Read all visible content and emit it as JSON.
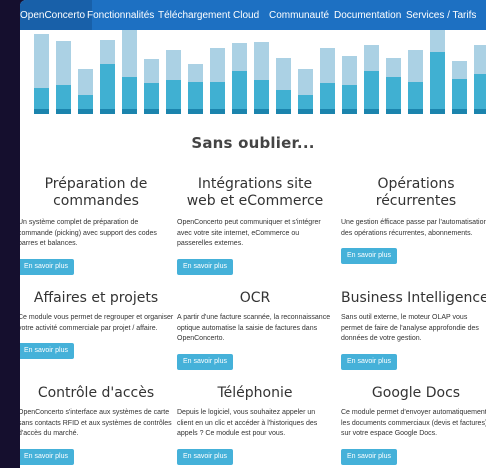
{
  "nav": {
    "items": [
      {
        "label": "OpenConcerto",
        "active": true
      },
      {
        "label": "Fonctionnalités",
        "active": false
      },
      {
        "label": "Téléchargement",
        "active": false
      },
      {
        "label": "Cloud",
        "active": false
      },
      {
        "label": "Communauté",
        "active": false
      },
      {
        "label": "Documentation",
        "active": false
      },
      {
        "label": "Services / Tarifs",
        "active": false
      }
    ]
  },
  "colors": {
    "nav_bg": "#1d70c2",
    "button_bg": "#45b1d9",
    "bar_light": "#abd1e4",
    "bar_mid": "#40b0d2",
    "bar_dark": "#1b84ad"
  },
  "hero": {
    "bars": [
      {
        "light": 0.68,
        "mid": 0.26,
        "dark": 0.06
      },
      {
        "light": 0.55,
        "mid": 0.3,
        "dark": 0.06
      },
      {
        "light": 0.32,
        "mid": 0.18,
        "dark": 0.06
      },
      {
        "light": 0.3,
        "mid": 0.56,
        "dark": 0.06
      },
      {
        "light": 0.8,
        "mid": 0.4,
        "dark": 0.06
      },
      {
        "light": 0.3,
        "mid": 0.32,
        "dark": 0.06
      },
      {
        "light": 0.38,
        "mid": 0.36,
        "dark": 0.06
      },
      {
        "light": 0.22,
        "mid": 0.34,
        "dark": 0.06
      },
      {
        "light": 0.42,
        "mid": 0.34,
        "dark": 0.06
      },
      {
        "light": 0.35,
        "mid": 0.48,
        "dark": 0.06
      },
      {
        "light": 0.48,
        "mid": 0.36,
        "dark": 0.06
      },
      {
        "light": 0.4,
        "mid": 0.24,
        "dark": 0.06
      },
      {
        "light": 0.32,
        "mid": 0.18,
        "dark": 0.06
      },
      {
        "light": 0.44,
        "mid": 0.32,
        "dark": 0.06
      },
      {
        "light": 0.36,
        "mid": 0.3,
        "dark": 0.06
      },
      {
        "light": 0.32,
        "mid": 0.48,
        "dark": 0.06
      },
      {
        "light": 0.24,
        "mid": 0.4,
        "dark": 0.06
      },
      {
        "light": 0.4,
        "mid": 0.34,
        "dark": 0.06
      },
      {
        "light": 0.3,
        "mid": 0.72,
        "dark": 0.06
      },
      {
        "light": 0.22,
        "mid": 0.38,
        "dark": 0.06
      },
      {
        "light": 0.36,
        "mid": 0.44,
        "dark": 0.06
      },
      {
        "light": 0.4,
        "mid": 0.28,
        "dark": 0.06
      }
    ]
  },
  "section": {
    "heading": "Sans oublier..."
  },
  "cards": [
    {
      "title": "Préparation de commandes",
      "text": "Un système complet de préparation de commande (picking) avec support des codes barres et balances.",
      "button": "En savoir plus"
    },
    {
      "title": "Intégrations site web et eCommerce",
      "text": "OpenConcerto peut communiquer et s'intégrer avec votre site internet, eCommerce ou passerelles externes.",
      "button": "En savoir plus"
    },
    {
      "title": "Opérations récurrentes",
      "text": "Une gestion éfficace passe par l'automatisation des opérations récurrentes, abonnements.",
      "button": "En savoir plus"
    },
    {
      "title": "Affaires et projets",
      "text": "Ce module vous permet de regrouper et organiser votre activité commerciale par projet / affaire.",
      "button": "En savoir plus"
    },
    {
      "title": "OCR",
      "text": "A partir d'une facture scannée, la reconnaissance optique automatise la saisie de factures dans OpenConcerto.",
      "button": "En savoir plus"
    },
    {
      "title": "Business Intelligence",
      "text": "Sans outil externe, le moteur OLAP vous permet de faire de l'analyse approfondie des données de votre gestion.",
      "button": "En savoir plus"
    },
    {
      "title": "Contrôle d'accès",
      "text": "OpenConcerto s'interface aux systèmes de carte sans contacts RFID et aux systèmes de contrôles d'accès du marché.",
      "button": "En savoir plus"
    },
    {
      "title": "Téléphonie",
      "text": "Depuis le logiciel, vous souhaitez appeler un client en un clic et accéder à l'historiques des appels ? Ce module est pour vous.",
      "button": "En savoir plus"
    },
    {
      "title": "Google Docs",
      "text": "Ce module permet d'envoyer automatiquement les documents commerciaux (devis et factures) sur votre espace Google Docs.",
      "button": "En savoir plus"
    }
  ]
}
